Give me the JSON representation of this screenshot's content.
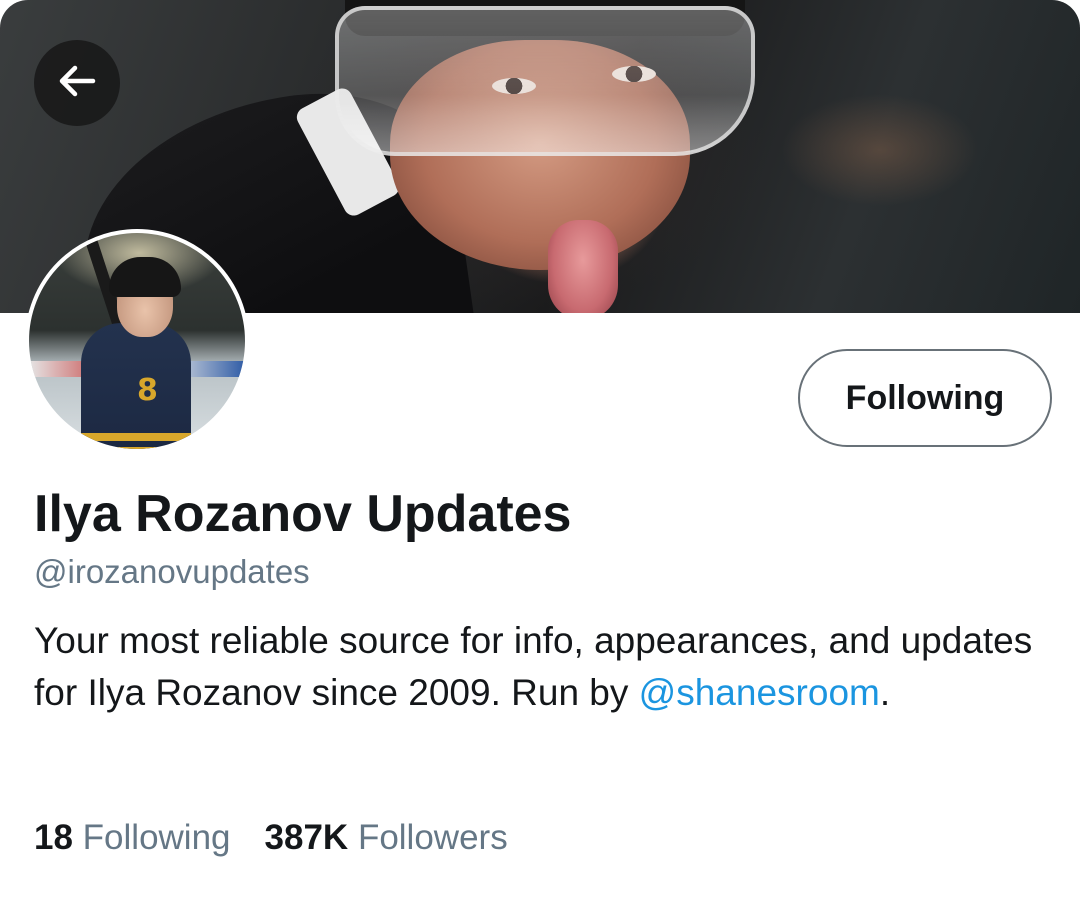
{
  "header": {
    "back_icon": "arrow-left-icon"
  },
  "profile": {
    "follow_button_label": "Following",
    "display_name": "Ilya Rozanov Updates",
    "handle": "@irozanovupdates",
    "bio_text": "Your most reliable source for info, appearances, and updates for Ilya Rozanov since 2009. Run by ",
    "bio_mention": "@shanesroom",
    "bio_end": ".",
    "avatar_jersey_number": "8"
  },
  "stats": {
    "following_count": "18",
    "following_label": "Following",
    "followers_count": "387K",
    "followers_label": "Followers"
  },
  "colors": {
    "link": "#1b95e0",
    "secondary_text": "#657786",
    "primary_text": "#14171a"
  }
}
